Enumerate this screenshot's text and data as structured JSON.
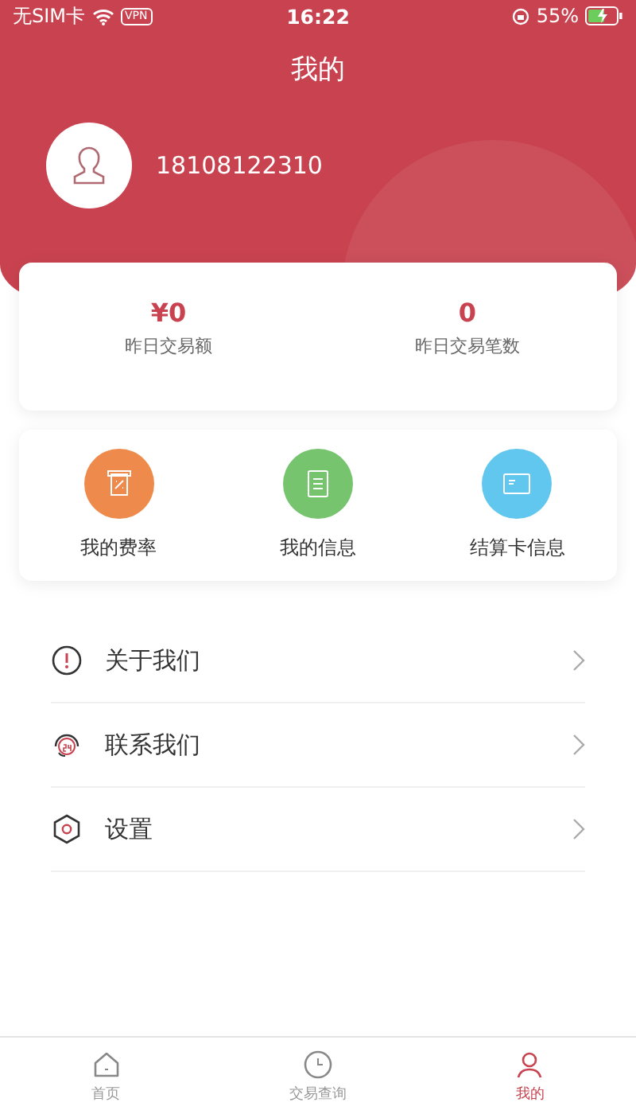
{
  "status_bar": {
    "carrier": "无SIM卡",
    "vpn": "VPN",
    "time": "16:22",
    "battery": "55%"
  },
  "header": {
    "title": "我的",
    "phone": "18108122310"
  },
  "stats": [
    {
      "value": "¥0",
      "label": "昨日交易额"
    },
    {
      "value": "0",
      "label": "昨日交易笔数"
    }
  ],
  "shortcuts": [
    {
      "kind": "rate",
      "label": "我的费率",
      "color": "#ee8a4b"
    },
    {
      "kind": "info",
      "label": "我的信息",
      "color": "#76c46e"
    },
    {
      "kind": "card",
      "label": "结算卡信息",
      "color": "#62c7ef"
    }
  ],
  "menu": [
    {
      "kind": "about",
      "label": "关于我们"
    },
    {
      "kind": "contact",
      "label": "联系我们"
    },
    {
      "kind": "settings",
      "label": "设置"
    }
  ],
  "tabs": [
    {
      "kind": "home",
      "label": "首页",
      "selected": false
    },
    {
      "kind": "query",
      "label": "交易查询",
      "selected": false
    },
    {
      "kind": "mine",
      "label": "我的",
      "selected": true
    }
  ]
}
